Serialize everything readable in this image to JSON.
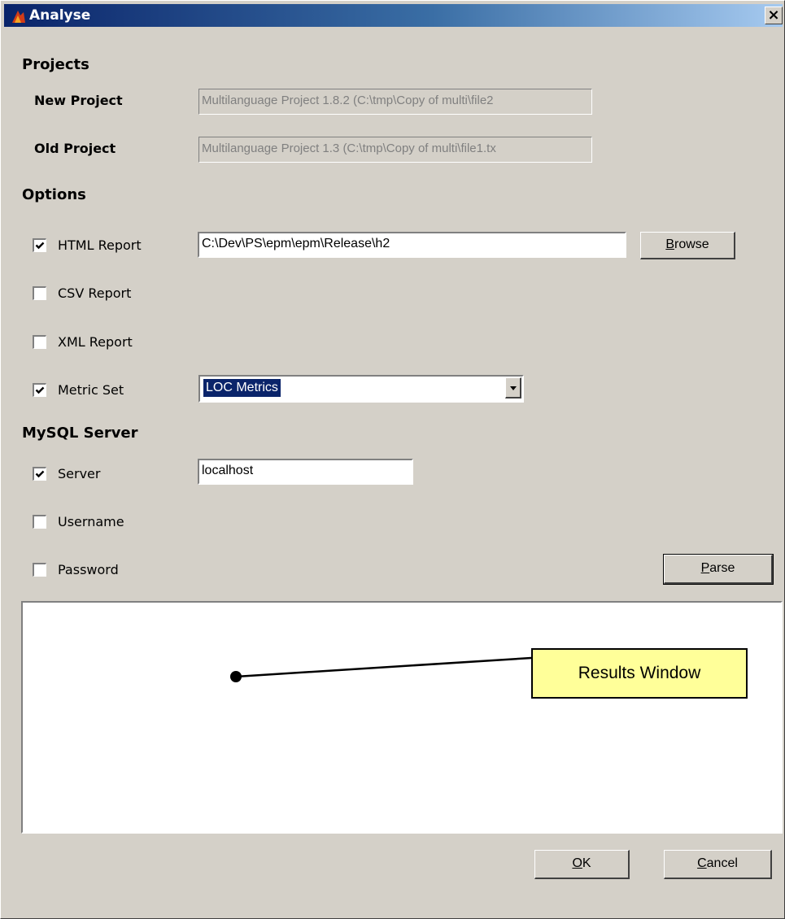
{
  "window": {
    "title": "Analyse",
    "close_glyph": "×",
    "icon": "app-icon"
  },
  "projects": {
    "heading": "Projects",
    "new_project_label": "New Project",
    "new_project_value": "Multilanguage Project 1.8.2 (C:\\tmp\\Copy of multi\\file2",
    "old_project_label": "Old Project",
    "old_project_value": "Multilanguage Project 1.3 (C:\\tmp\\Copy of multi\\file1.tx"
  },
  "options": {
    "heading": "Options",
    "html_report": {
      "label": "HTML Report",
      "checked": true,
      "path": "C:\\Dev\\PS\\epm\\epm\\Release\\h2"
    },
    "browse_button": {
      "prefix": "",
      "mnemonic": "B",
      "rest": "rowse"
    },
    "csv_report": {
      "label": "CSV Report",
      "checked": false
    },
    "xml_report": {
      "label": "XML Report",
      "checked": false
    },
    "metric_set": {
      "label": "Metric Set",
      "checked": true,
      "selected": "LOC Metrics"
    }
  },
  "mysql": {
    "heading": "MySQL Server",
    "server": {
      "label": "Server",
      "checked": true,
      "value": "localhost"
    },
    "username": {
      "label": "Username",
      "checked": false
    },
    "password": {
      "label": "Password",
      "checked": false
    }
  },
  "parse_button": {
    "mnemonic": "P",
    "rest": "arse"
  },
  "results": {
    "callout_text": "Results Window"
  },
  "footer": {
    "ok_button": {
      "mnemonic": "O",
      "rest": "K"
    },
    "cancel_button": {
      "mnemonic": "C",
      "rest": "ancel"
    }
  },
  "colors": {
    "window_bg": "#d4d0c8",
    "title_start": "#0a246a",
    "title_end": "#a6caf0",
    "callout_bg": "#ffff99",
    "selection": "#0a246a"
  }
}
